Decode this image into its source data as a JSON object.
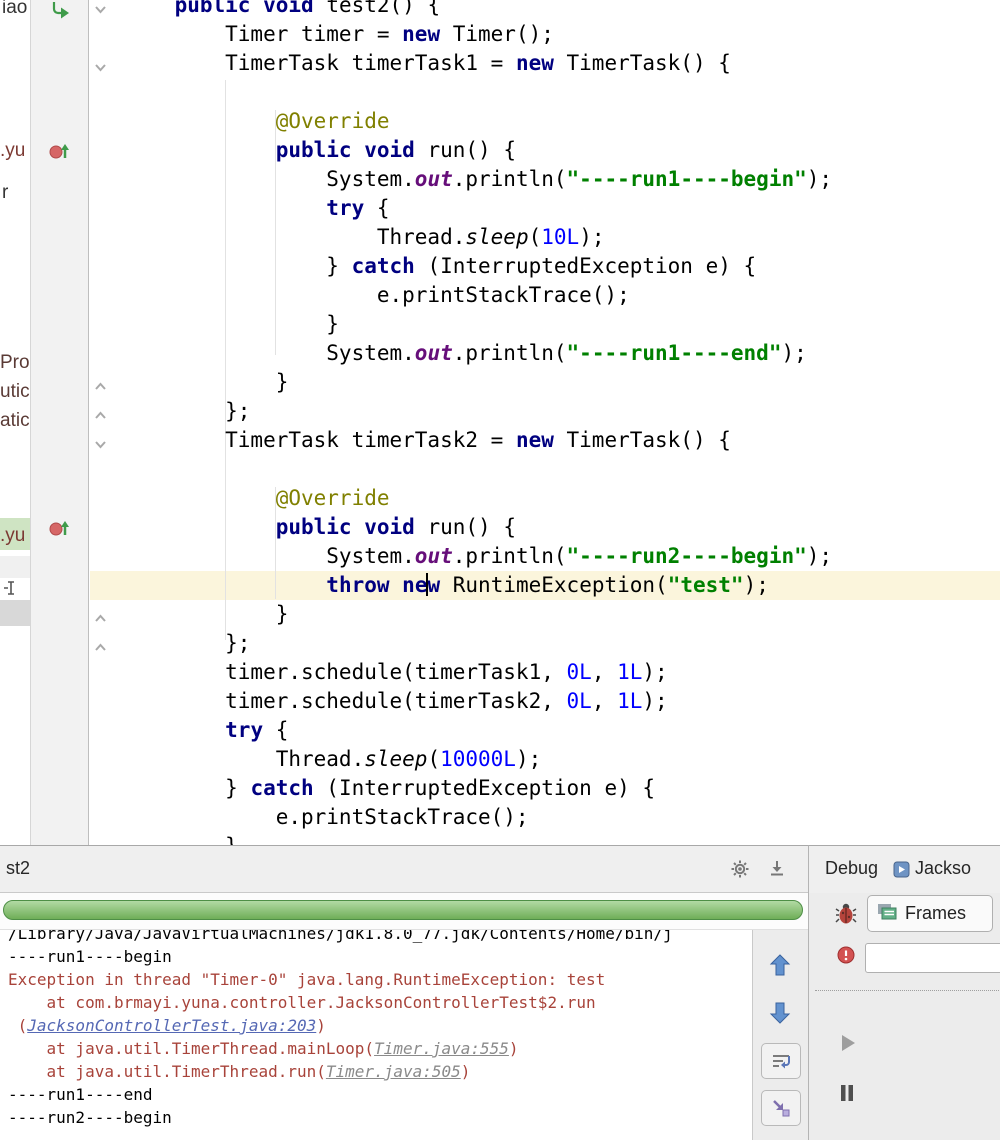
{
  "window": {
    "app_hint": "IntelliJ IDEA debug session"
  },
  "colors": {
    "keyword": "#000080",
    "string": "#008000",
    "number": "#0000ff",
    "annotation": "#808000",
    "static_field": "#660e7a",
    "error_output": "#a8433a",
    "link": "#5568b4",
    "link_grayed": "#8a8a8a",
    "progress_green": "#6fae58",
    "selection_green": "#cfe4c3",
    "current_line": "#fbf5dc",
    "breakpoint_red": "#d66666",
    "run_arrow_green": "#3f9b4a"
  },
  "icons": {
    "run_arrow": "curved green arrow",
    "method_breakpoint": "red circle + green up arrow",
    "gear": "settings gear",
    "scroll_to_end": "down arrow to bar",
    "bug": "debug ladybug",
    "stop": "red circle",
    "resume": "gray play triangle",
    "pause": "two bars",
    "frames": "stacked green windows",
    "prev": "blue up arrow",
    "next": "blue down arrow",
    "soft_wrap": "wrap lines arrow",
    "jump": "purple corner arrow",
    "fold_open": "chevron down",
    "fold_close": "chevron up",
    "run_configuration": "blue square with play",
    "ibeam": "i-beam mark"
  },
  "project_panel": {
    "fragments": [
      "iao",
      ".yu",
      "r",
      "Pro",
      "utic",
      "atic",
      ".yu"
    ]
  },
  "editor": {
    "lines": [
      [
        {
          "t": "    "
        },
        {
          "t": "public",
          "c": "kw"
        },
        {
          "t": " "
        },
        {
          "t": "void",
          "c": "kw"
        },
        {
          "t": " test2() {"
        }
      ],
      [
        {
          "t": "        Timer timer = "
        },
        {
          "t": "new",
          "c": "kw"
        },
        {
          "t": " Timer();"
        }
      ],
      [
        {
          "t": "        TimerTask timerTask1 = "
        },
        {
          "t": "new",
          "c": "kw"
        },
        {
          "t": " TimerTask() {"
        }
      ],
      [
        {
          "t": ""
        }
      ],
      [
        {
          "t": "            "
        },
        {
          "t": "@Override",
          "c": "ann"
        }
      ],
      [
        {
          "t": "            "
        },
        {
          "t": "public",
          "c": "kw"
        },
        {
          "t": " "
        },
        {
          "t": "void",
          "c": "kw"
        },
        {
          "t": " run() {"
        }
      ],
      [
        {
          "t": "                System."
        },
        {
          "t": "out",
          "c": "field"
        },
        {
          "t": ".println("
        },
        {
          "t": "\"----run1----begin\"",
          "c": "str"
        },
        {
          "t": ");"
        }
      ],
      [
        {
          "t": "                "
        },
        {
          "t": "try",
          "c": "kw"
        },
        {
          "t": " {"
        }
      ],
      [
        {
          "t": "                    Thread."
        },
        {
          "t": "sleep",
          "c": "stat"
        },
        {
          "t": "("
        },
        {
          "t": "10L",
          "c": "num"
        },
        {
          "t": ");"
        }
      ],
      [
        {
          "t": "                } "
        },
        {
          "t": "catch",
          "c": "kw"
        },
        {
          "t": " (InterruptedException e) {"
        }
      ],
      [
        {
          "t": "                    e.printStackTrace();"
        }
      ],
      [
        {
          "t": "                }"
        }
      ],
      [
        {
          "t": "                System."
        },
        {
          "t": "out",
          "c": "field"
        },
        {
          "t": ".println("
        },
        {
          "t": "\"----run1----end\"",
          "c": "str"
        },
        {
          "t": ");"
        }
      ],
      [
        {
          "t": "            }"
        }
      ],
      [
        {
          "t": "        };"
        }
      ],
      [
        {
          "t": "        TimerTask timerTask2 = "
        },
        {
          "t": "new",
          "c": "kw"
        },
        {
          "t": " TimerTask() {"
        }
      ],
      [
        {
          "t": ""
        }
      ],
      [
        {
          "t": "            "
        },
        {
          "t": "@Override",
          "c": "ann"
        }
      ],
      [
        {
          "t": "            "
        },
        {
          "t": "public",
          "c": "kw"
        },
        {
          "t": " "
        },
        {
          "t": "void",
          "c": "kw"
        },
        {
          "t": " run() {"
        }
      ],
      [
        {
          "t": "                System."
        },
        {
          "t": "out",
          "c": "field"
        },
        {
          "t": ".println("
        },
        {
          "t": "\"----run2----begin\"",
          "c": "str"
        },
        {
          "t": ");"
        }
      ],
      [
        {
          "t": "                "
        },
        {
          "t": "throw",
          "c": "kw"
        },
        {
          "t": " "
        },
        {
          "t": "ne",
          "c": "kw"
        },
        {
          "caret": true
        },
        {
          "t": "w",
          "c": "kw"
        },
        {
          "t": " RuntimeException("
        },
        {
          "t": "\"test\"",
          "c": "str"
        },
        {
          "t": ");"
        }
      ],
      [
        {
          "t": "            }"
        }
      ],
      [
        {
          "t": "        };"
        }
      ],
      [
        {
          "t": "        timer.schedule(timerTask1, "
        },
        {
          "t": "0L",
          "c": "num"
        },
        {
          "t": ", "
        },
        {
          "t": "1L",
          "c": "num"
        },
        {
          "t": ");"
        }
      ],
      [
        {
          "t": "        timer.schedule(timerTask2, "
        },
        {
          "t": "0L",
          "c": "num"
        },
        {
          "t": ", "
        },
        {
          "t": "1L",
          "c": "num"
        },
        {
          "t": ");"
        }
      ],
      [
        {
          "t": "        "
        },
        {
          "t": "try",
          "c": "kw"
        },
        {
          "t": " {"
        }
      ],
      [
        {
          "t": "            Thread."
        },
        {
          "t": "sleep",
          "c": "stat"
        },
        {
          "t": "("
        },
        {
          "t": "10000L",
          "c": "num"
        },
        {
          "t": ");"
        }
      ],
      [
        {
          "t": "        } "
        },
        {
          "t": "catch",
          "c": "kw"
        },
        {
          "t": " (InterruptedException e) {"
        }
      ],
      [
        {
          "t": "            e.printStackTrace();"
        }
      ],
      [
        {
          "t": "        }"
        }
      ]
    ]
  },
  "run_panel": {
    "tab_label": "st2"
  },
  "console": {
    "lines": [
      [
        {
          "t": "/Library/Java/JavaVirtualMachines/jdk1.8.0_77.jdk/Contents/Home/bin/j"
        }
      ],
      [
        {
          "t": "----run1----begin"
        }
      ],
      [
        {
          "t": "Exception in thread \"Timer-0\" java.lang.RuntimeException: test",
          "c": "err"
        }
      ],
      [
        {
          "t": "    at com.brmayi.yuna.controller.JacksonControllerTest$2.run",
          "c": "err"
        }
      ],
      [
        {
          "t": " (",
          "c": "err"
        },
        {
          "t": "JacksonControllerTest.java:203",
          "c": "lnk"
        },
        {
          "t": ")",
          "c": "err"
        }
      ],
      [
        {
          "t": "    at java.util.TimerThread.mainLoop(",
          "c": "err"
        },
        {
          "t": "Timer.java:555",
          "c": "lnkg"
        },
        {
          "t": ")",
          "c": "err"
        }
      ],
      [
        {
          "t": "    at java.util.TimerThread.run(",
          "c": "err"
        },
        {
          "t": "Timer.java:505",
          "c": "lnkg"
        },
        {
          "t": ")",
          "c": "err"
        }
      ],
      [
        {
          "t": "----run1----end"
        }
      ],
      [
        {
          "t": "----run2----begin"
        }
      ]
    ]
  },
  "debug_panel": {
    "title": "Debug",
    "session_label": "Jackso",
    "frames_tab_label": "Frames"
  }
}
